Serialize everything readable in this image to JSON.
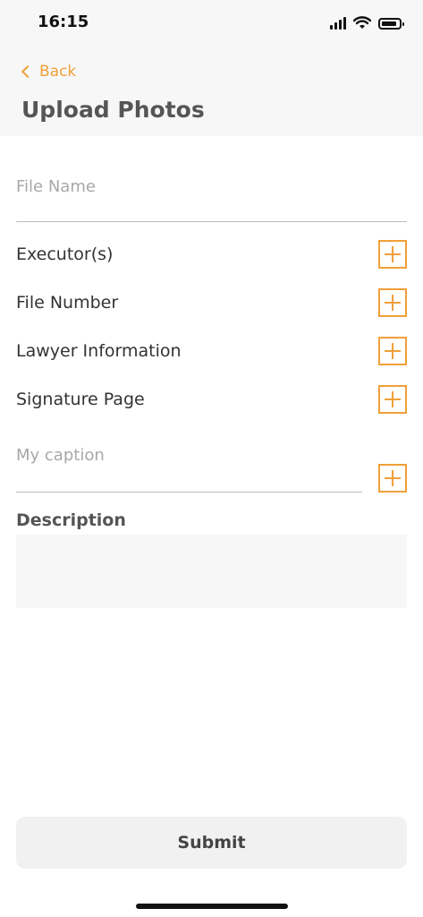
{
  "status_bar": {
    "time": "16:15",
    "icons": [
      "cellular-signal-icon",
      "wifi-icon",
      "battery-icon"
    ]
  },
  "header": {
    "back_label": "Back",
    "title": "Upload Photos"
  },
  "form": {
    "file_name_placeholder": "File Name",
    "rows": [
      {
        "label": "Executor(s)"
      },
      {
        "label": "File Number"
      },
      {
        "label": "Lawyer Information"
      },
      {
        "label": "Signature Page"
      }
    ],
    "caption_placeholder": "My caption",
    "description_label": "Description",
    "description_value": ""
  },
  "actions": {
    "submit_label": "Submit"
  },
  "colors": {
    "accent": "#f0a03a",
    "header_bg": "#f7f7f7",
    "text": "#333333"
  }
}
